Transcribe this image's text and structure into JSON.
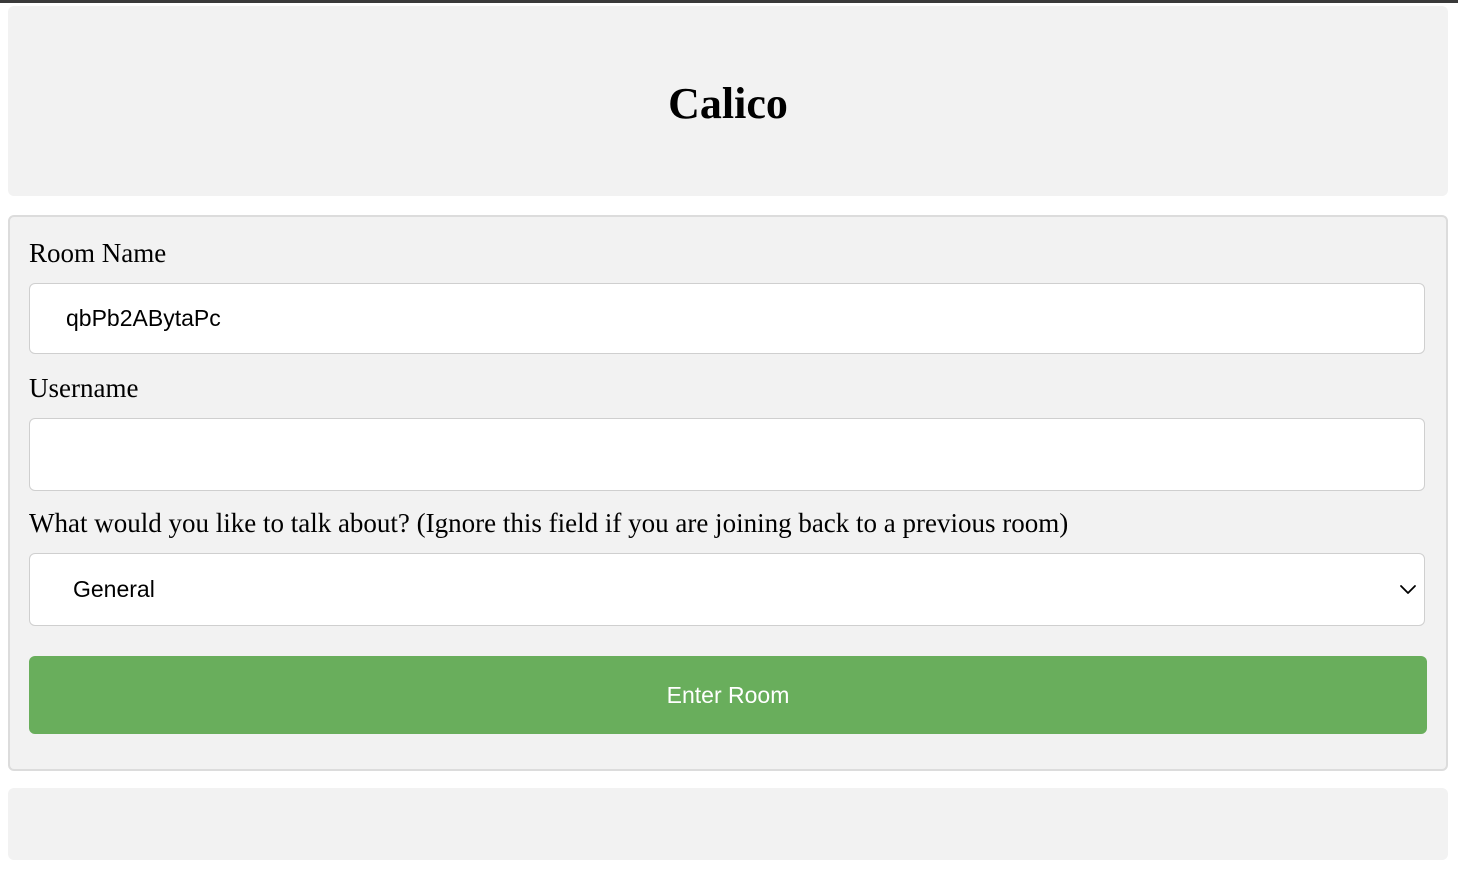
{
  "app": {
    "title": "Calico"
  },
  "form": {
    "room_name_label": "Room Name",
    "room_name_value": "qbPb2ABytaPc",
    "username_label": "Username",
    "username_value": "",
    "topic_label": "What would you like to talk about? (Ignore this field if you are joining back to a previous room)",
    "topic_selected": "General",
    "submit_label": "Enter Room"
  },
  "colors": {
    "accent_button": "#69ae5c",
    "panel_background": "#f2f2f2"
  },
  "icons": {
    "select_caret": "chevron-down-icon"
  }
}
